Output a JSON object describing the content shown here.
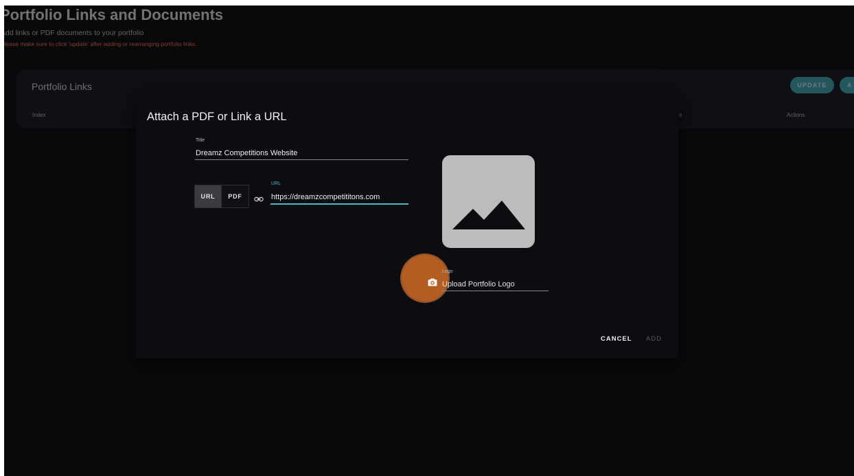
{
  "page": {
    "title": "Portfolio Links and Documents",
    "subtitle": "Add links or PDF documents to your portfolio",
    "warning": "Please make sure to click 'update' after adding or rearranging portfolio links."
  },
  "links_card": {
    "title": "Portfolio Links",
    "columns": {
      "index": "Index",
      "partial": "e",
      "actions": "Actions"
    },
    "update_label": "UPDATE",
    "add_label": "A"
  },
  "dialog": {
    "title": "Attach a PDF or Link a URL",
    "title_field": {
      "label": "Title",
      "value": "Dreamz Competitions Website"
    },
    "toggle": {
      "url_label": "URL",
      "pdf_label": "PDF",
      "selected": "URL"
    },
    "url_field": {
      "label": "URL",
      "value": "https://dreamzcompetititons.com"
    },
    "logo_field": {
      "label": "Logo",
      "placeholder": "Upload Portfolio Logo"
    },
    "cancel_label": "CANCEL",
    "add_label": "ADD"
  },
  "colors": {
    "accent": "#4fb9c4",
    "warning": "#e0683d",
    "highlight": "#d16c26",
    "background": "#09090c",
    "dialog": "#0c0c11"
  },
  "icons": [
    "link-icon",
    "camera-icon",
    "image-placeholder-icon"
  ]
}
